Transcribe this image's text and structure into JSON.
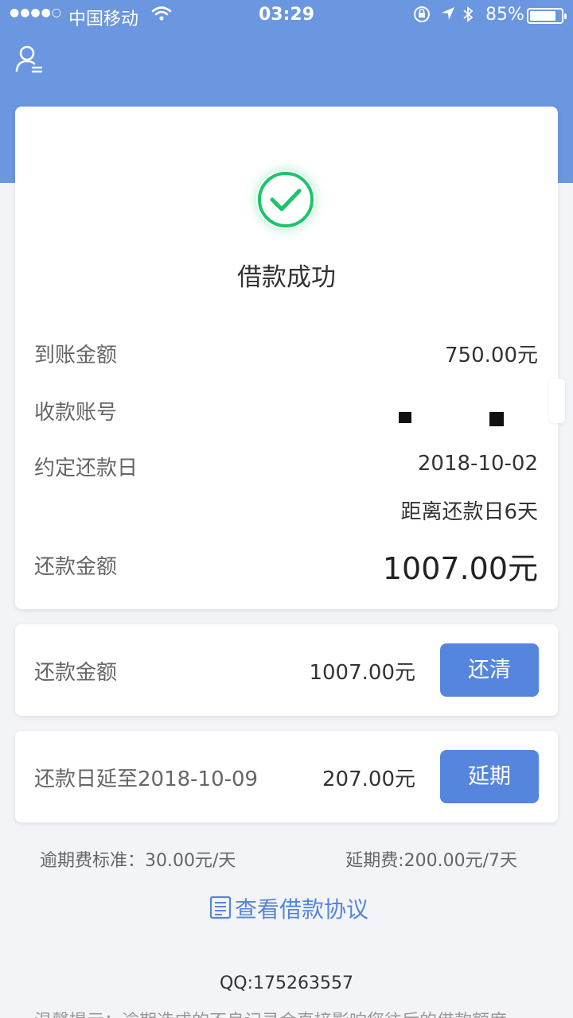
{
  "status_bar": {
    "signal": "●●●●○",
    "carrier": "中国移动",
    "time": "03:29",
    "battery_pct": "85%",
    "battery_level": 0.85
  },
  "result": {
    "title": "借款成功",
    "rows": {
      "received_label": "到账金额",
      "received_value": "750.00元",
      "account_label": "收款账号",
      "due_label": "约定还款日",
      "due_value": "2018-10-02",
      "countdown": "距离还款日6天",
      "repay_label": "还款金额",
      "repay_value": "1007.00元"
    }
  },
  "repay_card": {
    "label": "还款金额",
    "amount": "1007.00元",
    "button": "还清"
  },
  "extend_card": {
    "label": "还款日延至2018-10-09",
    "amount": "207.00元",
    "button": "延期"
  },
  "fees": {
    "overdue": "逾期费标准：30.00元/天",
    "extension": "延期费:200.00元/7天"
  },
  "agreement_link": "查看借款协议",
  "qq": "QQ:175263557",
  "tip": "温馨提示：逾期造成的不良记录会直接影响您往后的借款额度",
  "colors": {
    "header": "#6b96e0",
    "accent": "#5585dc",
    "success": "#1bc46a"
  }
}
